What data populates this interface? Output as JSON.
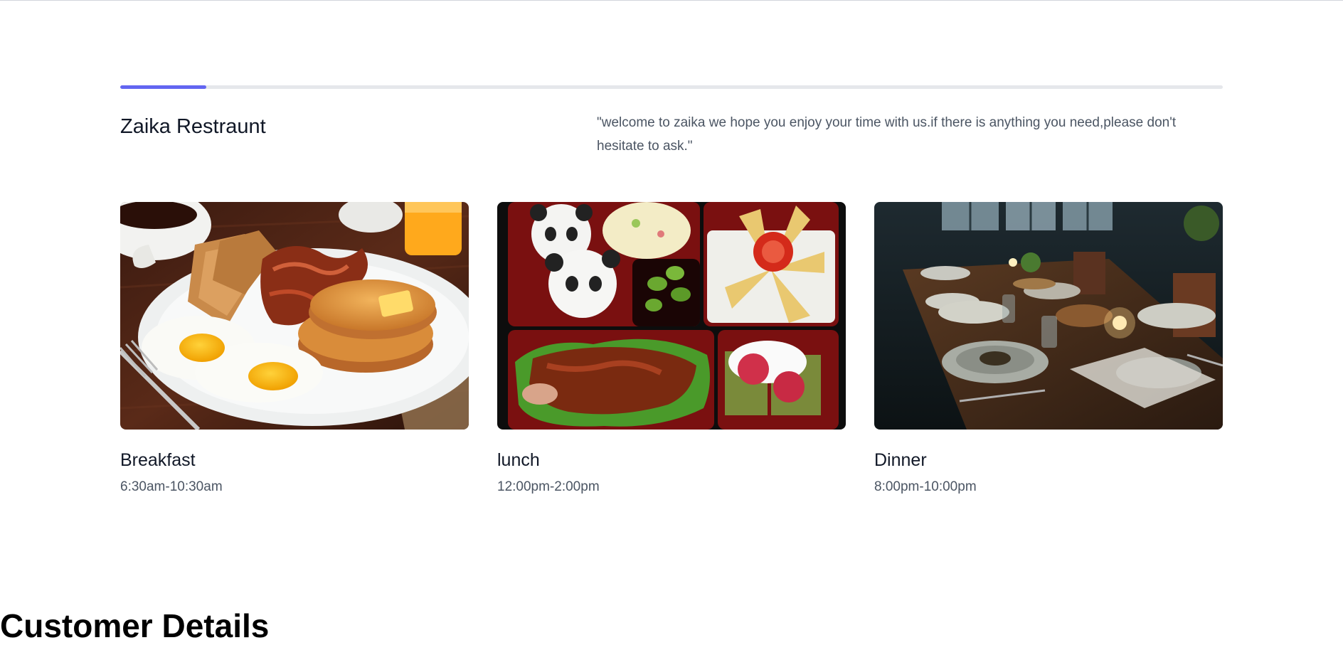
{
  "restaurant": {
    "name": "Zaika Restraunt",
    "welcome": "\"welcome to zaika we hope you enjoy your time with us.if there is anything you need,please don't hesitate to ask.\""
  },
  "progress": {
    "percent": 7.8,
    "color": "#6366f1"
  },
  "meals": [
    {
      "name": "Breakfast",
      "time": "6:30am-10:30am",
      "image": "breakfast-plate"
    },
    {
      "name": "lunch",
      "time": "12:00pm-2:00pm",
      "image": "bento-box"
    },
    {
      "name": "Dinner",
      "time": "8:00pm-10:00pm",
      "image": "dinner-table"
    }
  ],
  "section": {
    "heading": "Customer Details"
  }
}
